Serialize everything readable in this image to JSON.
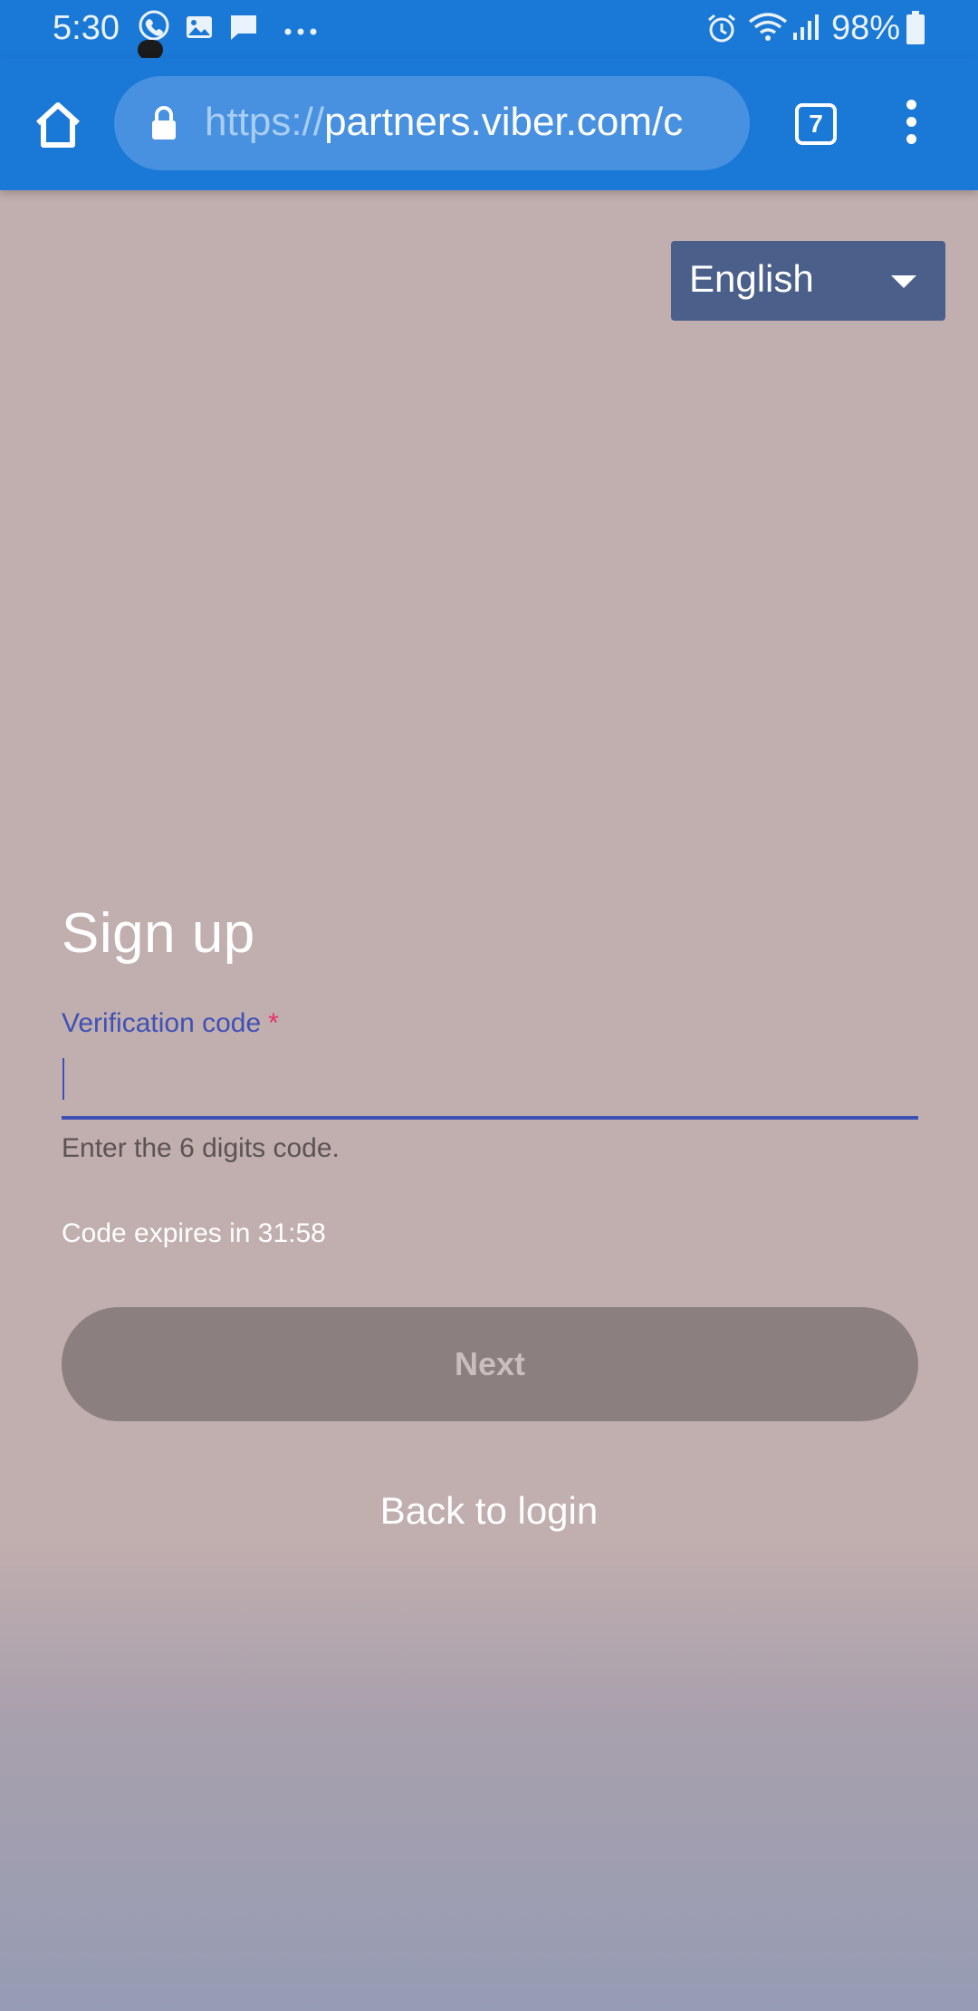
{
  "status_bar": {
    "time": "5:30",
    "battery": "98%",
    "notification_icons": [
      "viber-icon",
      "image-icon",
      "chat-icon",
      "more-dots-icon"
    ],
    "system_icons": [
      "alarm-icon",
      "wifi-icon",
      "signal-icon",
      "battery-icon"
    ]
  },
  "browser": {
    "url_scheme": "https://",
    "url_rest": "partners.viber.com/c",
    "tab_count": "7"
  },
  "language_select": {
    "selected": "English"
  },
  "form": {
    "title": "Sign up",
    "field_label": "Verification code",
    "required_marker": "*",
    "field_value": "",
    "hint": "Enter the 6 digits code.",
    "expires": "Code expires in 31:58",
    "next_label": "Next",
    "back_label": "Back to login"
  },
  "colors": {
    "browser_bar": "#1a78d6",
    "accent": "#3f51b5",
    "required": "#e5316a",
    "button_disabled": "#8b7f7f",
    "background": "#c1aeae"
  }
}
